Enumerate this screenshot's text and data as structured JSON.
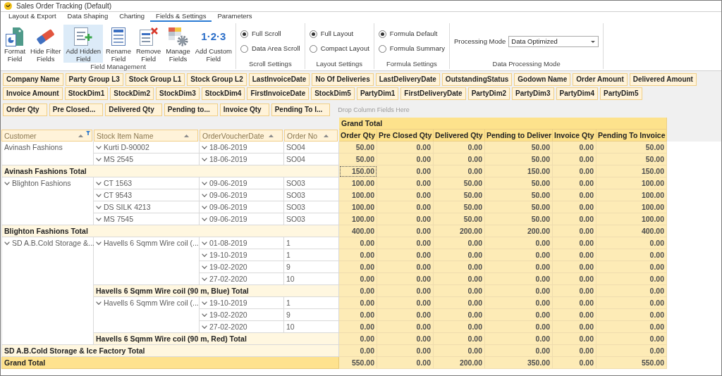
{
  "window": {
    "title": "Sales Order Tracking (Default)"
  },
  "ribbon_tabs": [
    {
      "label": "Layout & Export",
      "selected": false
    },
    {
      "label": "Data Shaping",
      "selected": false
    },
    {
      "label": "Charting",
      "selected": false
    },
    {
      "label": "Fields & Settings",
      "selected": true
    },
    {
      "label": "Parameters",
      "selected": false
    }
  ],
  "ribbon_groups": [
    {
      "kind": "buttons",
      "title": "Field Management",
      "buttons": [
        {
          "kind": "format",
          "lines": [
            "Format",
            "Field"
          ],
          "selected": false
        },
        {
          "kind": "eraser",
          "lines": [
            "Hide Filter",
            "Fields"
          ],
          "selected": false
        },
        {
          "kind": "add",
          "lines": [
            "Add Hidden",
            "Field"
          ],
          "selected": true
        },
        {
          "kind": "rename",
          "lines": [
            "Rename",
            "Field"
          ],
          "selected": false
        },
        {
          "kind": "remove",
          "lines": [
            "Remove",
            "Field"
          ],
          "selected": false
        },
        {
          "kind": "manage",
          "lines": [
            "Manage",
            "Fields"
          ],
          "selected": false
        },
        {
          "kind": "numbers",
          "glyph": "1·2·3",
          "lines": [
            "Add Custom",
            "Field"
          ],
          "selected": false
        }
      ]
    },
    {
      "kind": "radios",
      "title": "Scroll Settings",
      "options": [
        {
          "label": "Full Scroll",
          "selected": true
        },
        {
          "label": "Data Area Scroll",
          "selected": false
        }
      ]
    },
    {
      "kind": "radios",
      "title": "Layout Settings",
      "options": [
        {
          "label": "Full Layout",
          "selected": true
        },
        {
          "label": "Compact Layout",
          "selected": false
        }
      ]
    },
    {
      "kind": "radios",
      "title": "Formula Settings",
      "options": [
        {
          "label": "Formula Default",
          "selected": true
        },
        {
          "label": "Formula Summary",
          "selected": false
        }
      ]
    },
    {
      "kind": "select",
      "title": "Data Processing Mode",
      "label": "Processing Mode",
      "value": "Data Optimized"
    }
  ],
  "filter_fields": [
    "Company Name",
    "Party Group L3",
    "Stock Group L1",
    "Stock Group L2",
    "LastInvoiceDate",
    "No Of Deliveries",
    "LastDeliveryDate",
    "OutstandingStatus",
    "Godown Name",
    "Order Amount",
    "Delivered Amount",
    "Invoice Amount",
    "StockDim1",
    "StockDim2",
    "StockDim3",
    "StockDim4",
    "FirstInvoiceDate",
    "StockDim5",
    "PartyDim1",
    "FirstDeliveryDate",
    "PartyDim2",
    "PartyDim3",
    "PartyDim4",
    "PartyDim5"
  ],
  "data_fields": [
    "Order Qty",
    "Pre Closed...",
    "Delivered Qty",
    "Pending to...",
    "Invoice Qty",
    "Pending To I..."
  ],
  "column_drop_area": {
    "placeholder": "Drop Column Fields Here"
  },
  "pivot": {
    "row_fields": [
      {
        "label": "Customer",
        "sorted": true,
        "filtered": true
      },
      {
        "label": "Stock Item Name",
        "sorted": true,
        "filtered": false
      },
      {
        "label": "OrderVoucherDate",
        "sorted": true,
        "filtered": false
      },
      {
        "label": "Order No",
        "sorted": true,
        "filtered": false
      }
    ],
    "column_header": "Grand Total",
    "columns": [
      "Order Qty",
      "Pre Closed Qty",
      "Delivered Qty",
      "Pending to Deliver",
      "Invoice Qty",
      "Pending To Invoice"
    ],
    "customers": [
      {
        "name": "Avinash Fashions",
        "expand_button": false,
        "children": [
          {
            "name": "Kurti D-90002",
            "expand_button": true,
            "children": [
              {
                "date": "18-06-2019",
                "expand_button": true,
                "order_no": "SO04",
                "values": [
                  {
                    "text": "50.00",
                    "focused": false
                  },
                  {
                    "text": "0.00",
                    "focused": false
                  },
                  {
                    "text": "0.00",
                    "focused": false
                  },
                  {
                    "text": "50.00",
                    "focused": false
                  },
                  {
                    "text": "0.00",
                    "focused": false
                  },
                  {
                    "text": "50.00",
                    "focused": false
                  }
                ]
              }
            ]
          },
          {
            "name": "MS 2545",
            "expand_button": true,
            "children": [
              {
                "date": "18-06-2019",
                "expand_button": true,
                "order_no": "SO04",
                "values": [
                  {
                    "text": "50.00",
                    "focused": false
                  },
                  {
                    "text": "0.00",
                    "focused": false
                  },
                  {
                    "text": "0.00",
                    "focused": false
                  },
                  {
                    "text": "50.00",
                    "focused": false
                  },
                  {
                    "text": "0.00",
                    "focused": false
                  },
                  {
                    "text": "50.00",
                    "focused": false
                  }
                ]
              }
            ]
          }
        ],
        "total": {
          "label": "Avinash Fashions Total",
          "values": [
            {
              "text": "150.00",
              "focused": true
            },
            {
              "text": "0.00",
              "focused": false
            },
            {
              "text": "0.00",
              "focused": false
            },
            {
              "text": "150.00",
              "focused": false
            },
            {
              "text": "0.00",
              "focused": false
            },
            {
              "text": "150.00",
              "focused": false
            }
          ]
        }
      },
      {
        "name": "Blighton Fashions",
        "expand_button": true,
        "children": [
          {
            "name": "CT 1563",
            "expand_button": true,
            "children": [
              {
                "date": "09-06-2019",
                "expand_button": true,
                "order_no": "SO03",
                "values": [
                  {
                    "text": "100.00",
                    "focused": false
                  },
                  {
                    "text": "0.00",
                    "focused": false
                  },
                  {
                    "text": "50.00",
                    "focused": false
                  },
                  {
                    "text": "50.00",
                    "focused": false
                  },
                  {
                    "text": "0.00",
                    "focused": false
                  },
                  {
                    "text": "100.00",
                    "focused": false
                  }
                ]
              }
            ]
          },
          {
            "name": "CT 9543",
            "expand_button": true,
            "children": [
              {
                "date": "09-06-2019",
                "expand_button": true,
                "order_no": "SO03",
                "values": [
                  {
                    "text": "100.00",
                    "focused": false
                  },
                  {
                    "text": "0.00",
                    "focused": false
                  },
                  {
                    "text": "50.00",
                    "focused": false
                  },
                  {
                    "text": "50.00",
                    "focused": false
                  },
                  {
                    "text": "0.00",
                    "focused": false
                  },
                  {
                    "text": "100.00",
                    "focused": false
                  }
                ]
              }
            ]
          },
          {
            "name": "DS SILK 4213",
            "expand_button": true,
            "children": [
              {
                "date": "09-06-2019",
                "expand_button": true,
                "order_no": "SO03",
                "values": [
                  {
                    "text": "100.00",
                    "focused": false
                  },
                  {
                    "text": "0.00",
                    "focused": false
                  },
                  {
                    "text": "50.00",
                    "focused": false
                  },
                  {
                    "text": "50.00",
                    "focused": false
                  },
                  {
                    "text": "0.00",
                    "focused": false
                  },
                  {
                    "text": "100.00",
                    "focused": false
                  }
                ]
              }
            ]
          },
          {
            "name": "MS 7545",
            "expand_button": true,
            "children": [
              {
                "date": "09-06-2019",
                "expand_button": true,
                "order_no": "SO03",
                "values": [
                  {
                    "text": "100.00",
                    "focused": false
                  },
                  {
                    "text": "0.00",
                    "focused": false
                  },
                  {
                    "text": "50.00",
                    "focused": false
                  },
                  {
                    "text": "50.00",
                    "focused": false
                  },
                  {
                    "text": "0.00",
                    "focused": false
                  },
                  {
                    "text": "100.00",
                    "focused": false
                  }
                ]
              }
            ]
          }
        ],
        "total": {
          "label": "Blighton Fashions Total",
          "values": [
            {
              "text": "400.00",
              "focused": false
            },
            {
              "text": "0.00",
              "focused": false
            },
            {
              "text": "200.00",
              "focused": false
            },
            {
              "text": "200.00",
              "focused": false
            },
            {
              "text": "0.00",
              "focused": false
            },
            {
              "text": "400.00",
              "focused": false
            }
          ]
        }
      },
      {
        "name": "SD A.B.Cold Storage &...",
        "expand_button": true,
        "children": [
          {
            "name": "Havells 6 Sqmm Wire coil (...",
            "expand_button": true,
            "children": [
              {
                "date": "01-08-2019",
                "expand_button": true,
                "order_no": "1",
                "values": [
                  {
                    "text": "0.00",
                    "focused": false
                  },
                  {
                    "text": "0.00",
                    "focused": false
                  },
                  {
                    "text": "0.00",
                    "focused": false
                  },
                  {
                    "text": "0.00",
                    "focused": false
                  },
                  {
                    "text": "0.00",
                    "focused": false
                  },
                  {
                    "text": "0.00",
                    "focused": false
                  }
                ]
              },
              {
                "date": "19-10-2019",
                "expand_button": true,
                "order_no": "1",
                "values": [
                  {
                    "text": "0.00",
                    "focused": false
                  },
                  {
                    "text": "0.00",
                    "focused": false
                  },
                  {
                    "text": "0.00",
                    "focused": false
                  },
                  {
                    "text": "0.00",
                    "focused": false
                  },
                  {
                    "text": "0.00",
                    "focused": false
                  },
                  {
                    "text": "0.00",
                    "focused": false
                  }
                ]
              },
              {
                "date": "19-02-2020",
                "expand_button": true,
                "order_no": "9",
                "values": [
                  {
                    "text": "0.00",
                    "focused": false
                  },
                  {
                    "text": "0.00",
                    "focused": false
                  },
                  {
                    "text": "0.00",
                    "focused": false
                  },
                  {
                    "text": "0.00",
                    "focused": false
                  },
                  {
                    "text": "0.00",
                    "focused": false
                  },
                  {
                    "text": "0.00",
                    "focused": false
                  }
                ]
              },
              {
                "date": "27-02-2020",
                "expand_button": true,
                "order_no": "10",
                "values": [
                  {
                    "text": "0.00",
                    "focused": false
                  },
                  {
                    "text": "0.00",
                    "focused": false
                  },
                  {
                    "text": "0.00",
                    "focused": false
                  },
                  {
                    "text": "0.00",
                    "focused": false
                  },
                  {
                    "text": "0.00",
                    "focused": false
                  },
                  {
                    "text": "0.00",
                    "focused": false
                  }
                ]
              }
            ],
            "total": {
              "label": "Havells 6 Sqmm Wire coil (90 m, Blue) Total",
              "values": [
                {
                  "text": "0.00",
                  "focused": false
                },
                {
                  "text": "0.00",
                  "focused": false
                },
                {
                  "text": "0.00",
                  "focused": false
                },
                {
                  "text": "0.00",
                  "focused": false
                },
                {
                  "text": "0.00",
                  "focused": false
                },
                {
                  "text": "0.00",
                  "focused": false
                }
              ]
            }
          },
          {
            "name": "Havells 6 Sqmm Wire coil (...",
            "expand_button": true,
            "children": [
              {
                "date": "19-10-2019",
                "expand_button": true,
                "order_no": "1",
                "values": [
                  {
                    "text": "0.00",
                    "focused": false
                  },
                  {
                    "text": "0.00",
                    "focused": false
                  },
                  {
                    "text": "0.00",
                    "focused": false
                  },
                  {
                    "text": "0.00",
                    "focused": false
                  },
                  {
                    "text": "0.00",
                    "focused": false
                  },
                  {
                    "text": "0.00",
                    "focused": false
                  }
                ]
              },
              {
                "date": "19-02-2020",
                "expand_button": true,
                "order_no": "9",
                "values": [
                  {
                    "text": "0.00",
                    "focused": false
                  },
                  {
                    "text": "0.00",
                    "focused": false
                  },
                  {
                    "text": "0.00",
                    "focused": false
                  },
                  {
                    "text": "0.00",
                    "focused": false
                  },
                  {
                    "text": "0.00",
                    "focused": false
                  },
                  {
                    "text": "0.00",
                    "focused": false
                  }
                ]
              },
              {
                "date": "27-02-2020",
                "expand_button": true,
                "order_no": "10",
                "values": [
                  {
                    "text": "0.00",
                    "focused": false
                  },
                  {
                    "text": "0.00",
                    "focused": false
                  },
                  {
                    "text": "0.00",
                    "focused": false
                  },
                  {
                    "text": "0.00",
                    "focused": false
                  },
                  {
                    "text": "0.00",
                    "focused": false
                  },
                  {
                    "text": "0.00",
                    "focused": false
                  }
                ]
              }
            ],
            "total": {
              "label": "Havells 6 Sqmm Wire coil (90 m, Red) Total",
              "values": [
                {
                  "text": "0.00",
                  "focused": false
                },
                {
                  "text": "0.00",
                  "focused": false
                },
                {
                  "text": "0.00",
                  "focused": false
                },
                {
                  "text": "0.00",
                  "focused": false
                },
                {
                  "text": "0.00",
                  "focused": false
                },
                {
                  "text": "0.00",
                  "focused": false
                }
              ]
            }
          }
        ],
        "total": {
          "label": "SD A.B.Cold Storage & Ice Factory Total",
          "values": [
            {
              "text": "0.00",
              "focused": false
            },
            {
              "text": "0.00",
              "focused": false
            },
            {
              "text": "0.00",
              "focused": false
            },
            {
              "text": "0.00",
              "focused": false
            },
            {
              "text": "0.00",
              "focused": false
            },
            {
              "text": "0.00",
              "focused": false
            }
          ]
        }
      }
    ],
    "grand_total": {
      "label": "Grand Total",
      "values": [
        {
          "text": "550.00",
          "focused": false
        },
        {
          "text": "0.00",
          "focused": false
        },
        {
          "text": "200.00",
          "focused": false
        },
        {
          "text": "350.00",
          "focused": false
        },
        {
          "text": "0.00",
          "focused": false
        },
        {
          "text": "550.00",
          "focused": false
        }
      ]
    }
  }
}
